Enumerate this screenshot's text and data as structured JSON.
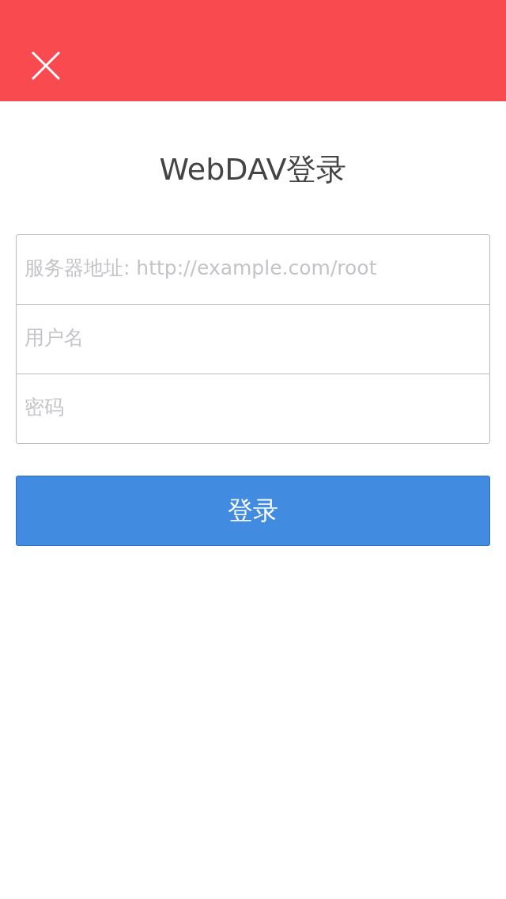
{
  "title": "WebDAV登录",
  "fields": [
    {
      "placeholder": "服务器地址: http://example.com/root"
    },
    {
      "placeholder": "用户名"
    },
    {
      "placeholder": "密码"
    }
  ],
  "button": "登录"
}
